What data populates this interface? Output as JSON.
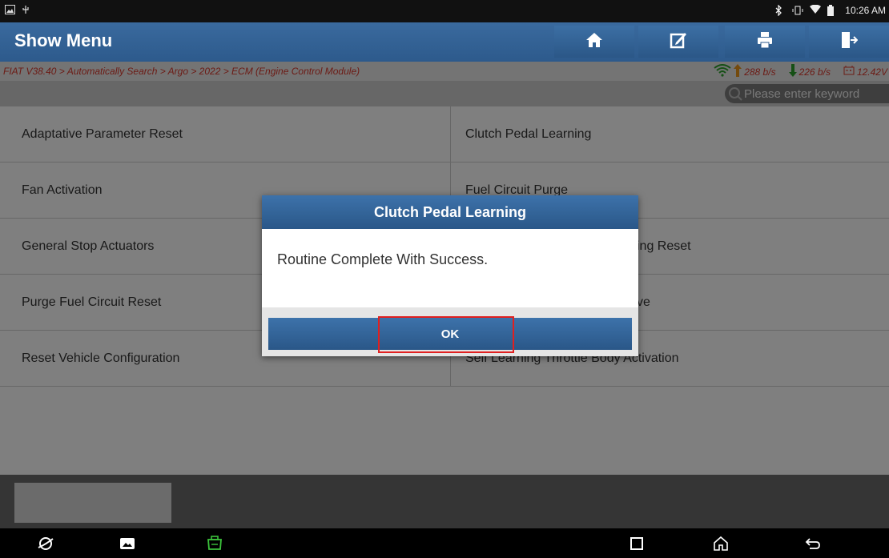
{
  "statusbar": {
    "time": "10:26 AM"
  },
  "header": {
    "title": "Show Menu",
    "buttons": [
      "home-icon",
      "edit-icon",
      "print-icon",
      "exit-icon"
    ]
  },
  "breadcrumb": {
    "path": "FIAT V38.40 > Automatically Search > Argo > 2022 > ECM (Engine Control Module)",
    "upload": "288 b/s",
    "download": "226 b/s",
    "voltage": "12.42V"
  },
  "search": {
    "placeholder": "Please enter keyword"
  },
  "menu": {
    "left": [
      "Adaptative Parameter Reset",
      "Fan Activation",
      "General Stop Actuators",
      "Purge Fuel Circuit Reset",
      "Reset Vehicle Configuration"
    ],
    "right": [
      "Clutch Pedal Learning",
      "Fuel Circuit Purge",
      "ing Reset",
      "ve",
      "Self Learning Throttle Body Activation"
    ]
  },
  "dialog": {
    "title": "Clutch Pedal Learning",
    "message": "Routine Complete With Success.",
    "ok_label": "OK"
  },
  "colors": {
    "header": "#2d5a8c",
    "accent_red": "#d9362a",
    "highlight": "#e02020",
    "stat_green": "#2ca02c"
  }
}
